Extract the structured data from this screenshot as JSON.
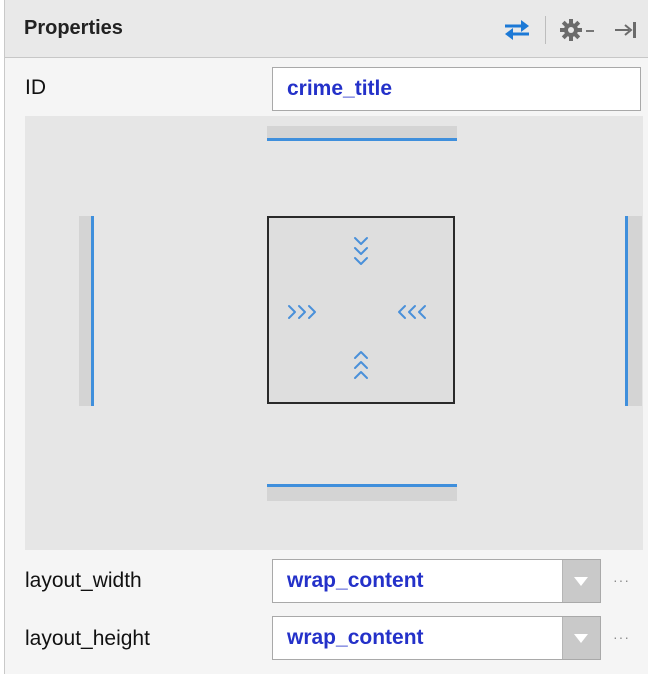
{
  "panel": {
    "title": "Properties",
    "icons": [
      "swap-arrows-icon",
      "gear-icon",
      "dropdown-caret-icon",
      "pin-to-edge-icon"
    ]
  },
  "id_row": {
    "label": "ID",
    "value": "crime_title"
  },
  "inspector": {
    "accent": "#3f8fdc",
    "width_glyph_left": ">>>",
    "width_glyph_right": "<<<",
    "height_glyph_top": "⌄",
    "height_glyph_bottom": "⌃"
  },
  "layout_width": {
    "label": "layout_width",
    "value": "wrap_content",
    "more": "···"
  },
  "layout_height": {
    "label": "layout_height",
    "value": "wrap_content",
    "more": "···"
  }
}
